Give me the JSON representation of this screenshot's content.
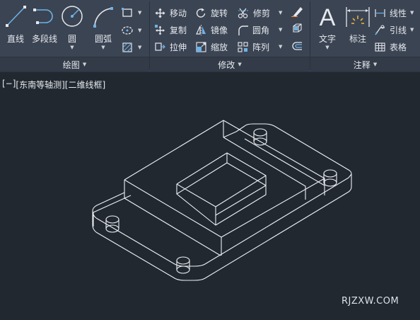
{
  "ribbon": {
    "draw_panel": {
      "title": "绘图",
      "buttons": {
        "line": "直线",
        "polyline": "多段线",
        "circle": "圆",
        "arc": "圆弧"
      }
    },
    "modify_panel": {
      "title": "修改",
      "buttons": {
        "move": "移动",
        "rotate": "旋转",
        "trim": "修剪",
        "copy": "复制",
        "mirror": "镜像",
        "fillet": "圆角",
        "stretch": "拉伸",
        "scale": "缩放",
        "array": "阵列"
      }
    },
    "annotation_panel": {
      "title": "注释",
      "buttons": {
        "text": "文字",
        "dimension": "标注",
        "linear": "线性",
        "leader": "引线",
        "table": "表格"
      }
    }
  },
  "viewport": {
    "controls": {
      "minus": "[−]",
      "view": "[东南等轴测]",
      "style": "[二维线框]"
    }
  },
  "watermark": "RJZXW.COM"
}
